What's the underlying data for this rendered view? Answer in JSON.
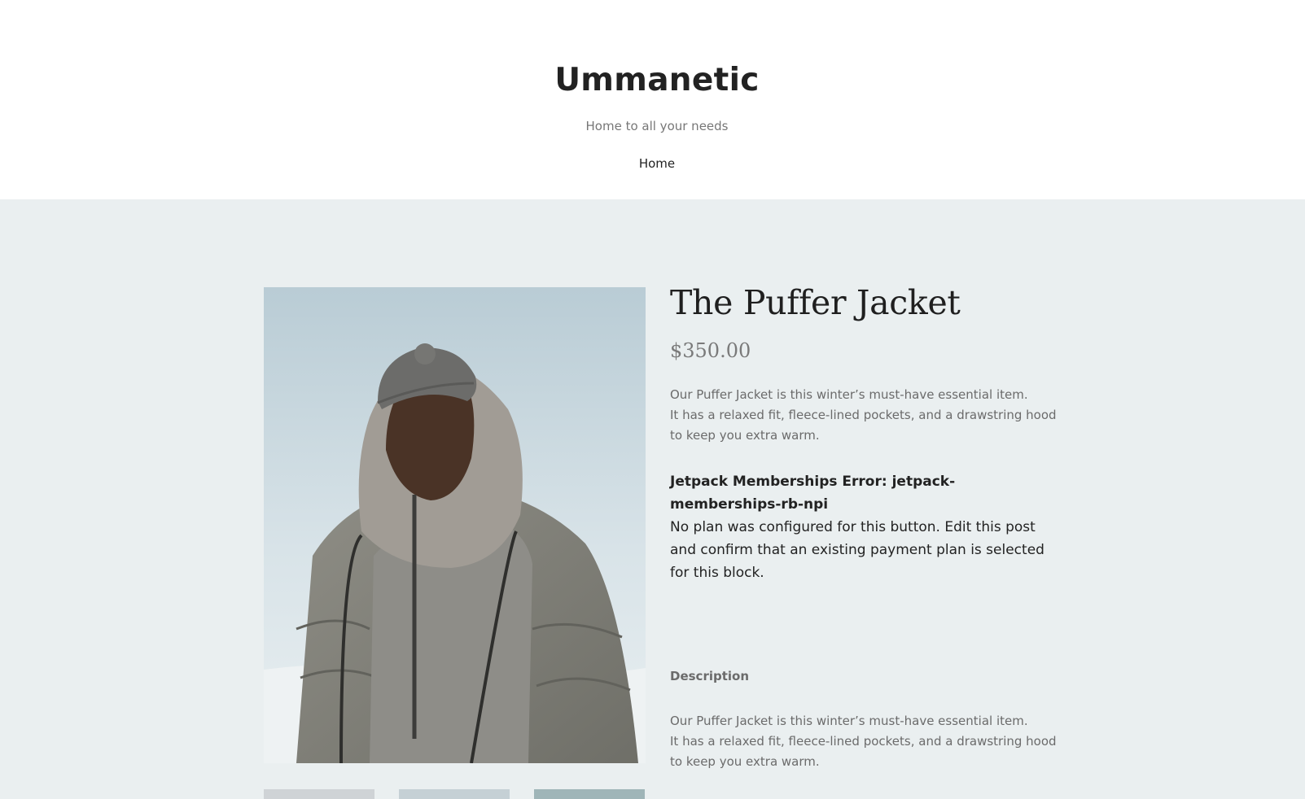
{
  "header": {
    "site_title": "Ummanetic",
    "tagline": "Home to all your needs",
    "nav": {
      "home_label": "Home"
    }
  },
  "product": {
    "title": "The Puffer Jacket",
    "price": "$350.00",
    "short_description": {
      "line1": "Our Puffer Jacket is this winter’s must-have essential item.",
      "line2": "It has a relaxed fit, fleece-lined pockets, and a drawstring hood to keep you extra warm."
    },
    "error": {
      "title": "Jetpack Memberships Error: jetpack-memberships-rb-npi",
      "message": "No plan was configured for this button. Edit this post and confirm that an existing payment plan is selected for this block."
    },
    "description_heading": "Description",
    "long_description": {
      "line1": "Our Puffer Jacket is this winter’s must-have essential item.",
      "line2": "It has a relaxed fit, fleece-lined pockets, and a drawstring hood to keep you extra warm."
    }
  },
  "colors": {
    "main_background": "#eaeff0",
    "header_background": "#ffffff",
    "muted_text": "#6b6b6b",
    "price_text": "#7a7a7a"
  }
}
